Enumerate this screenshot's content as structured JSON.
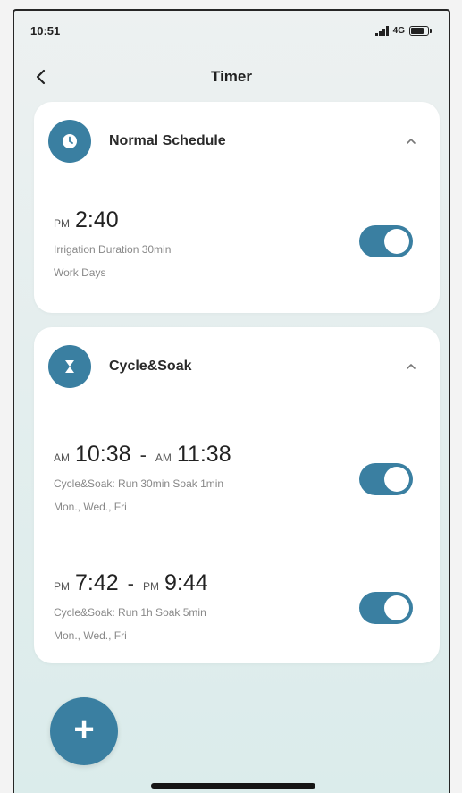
{
  "status_bar": {
    "time": "10:51",
    "network": "4G"
  },
  "nav": {
    "title": "Timer"
  },
  "normal_schedule": {
    "title": "Normal Schedule",
    "timers": [
      {
        "period": "PM",
        "time": "2:40",
        "line1": "Irrigation Duration 30min",
        "line2": "Work Days",
        "enabled": true
      }
    ]
  },
  "cycle_soak": {
    "title": "Cycle&Soak",
    "timers": [
      {
        "start_period": "AM",
        "start_time": "10:38",
        "sep": "-",
        "end_period": "AM",
        "end_time": "11:38",
        "line1": "Cycle&Soak: Run 30min Soak 1min",
        "line2": "Mon., Wed., Fri",
        "enabled": true
      },
      {
        "start_period": "PM",
        "start_time": "7:42",
        "sep": "-",
        "end_period": "PM",
        "end_time": "9:44",
        "line1": "Cycle&Soak: Run 1h Soak 5min",
        "line2": "Mon., Wed., Fri",
        "enabled": true
      }
    ]
  },
  "colors": {
    "accent": "#3a7fa1",
    "card": "#ffffff",
    "background": "#e4eeee"
  }
}
